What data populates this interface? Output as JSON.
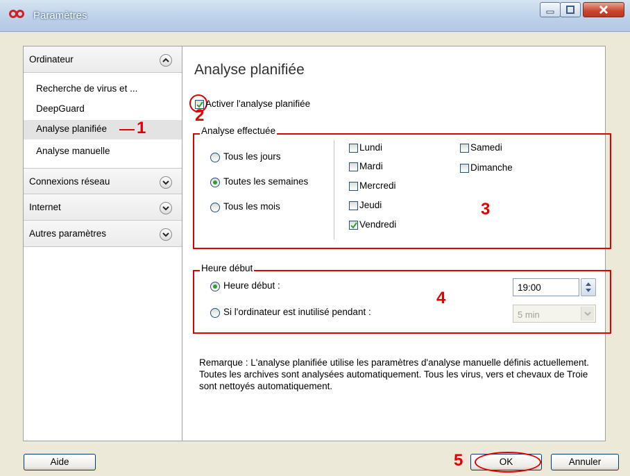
{
  "window": {
    "title": "Paramètres"
  },
  "sidebar": {
    "categories": [
      {
        "label": "Ordinateur",
        "expanded": true
      },
      {
        "label": "Connexions réseau"
      },
      {
        "label": "Internet"
      },
      {
        "label": "Autres paramètres"
      }
    ],
    "items": [
      {
        "label": "Recherche de virus et ..."
      },
      {
        "label": "DeepGuard"
      },
      {
        "label": "Analyse planifiée",
        "selected": true
      },
      {
        "label": "Analyse manuelle"
      }
    ]
  },
  "main": {
    "title": "Analyse planifiée",
    "enable_checkbox": {
      "label": "Activer l'analyse planifiée",
      "checked": true
    },
    "frequency_group": {
      "legend": "Analyse effectuée",
      "options": [
        {
          "label": "Tous les jours",
          "selected": false
        },
        {
          "label": "Toutes les semaines",
          "selected": true
        },
        {
          "label": "Tous les mois",
          "selected": false
        }
      ],
      "days": [
        {
          "label": "Lundi",
          "checked": false
        },
        {
          "label": "Mardi",
          "checked": false
        },
        {
          "label": "Mercredi",
          "checked": false
        },
        {
          "label": "Jeudi",
          "checked": false
        },
        {
          "label": "Vendredi",
          "checked": true
        },
        {
          "label": "Samedi",
          "checked": false
        },
        {
          "label": "Dimanche",
          "checked": false
        }
      ]
    },
    "start_group": {
      "legend": "Heure début",
      "start_time_label": "Heure début :",
      "start_time_value": "19:00",
      "idle_label": "Si l'ordinateur est inutilisé pendant :",
      "idle_value": "5 min"
    },
    "note": "Remarque : L'analyse planifiée utilise les paramètres d'analyse manuelle définis actuellement. Toutes les archives sont analysées automatiquement. Tous les virus, vers et chevaux de Troie sont nettoyés automatiquement."
  },
  "buttons": {
    "help": "Aide",
    "ok": "OK",
    "cancel": "Annuler"
  },
  "annotations": [
    "1",
    "2",
    "3",
    "4",
    "5"
  ],
  "colors": {
    "annotation": "#e00000",
    "radio_dot": "#2fa030",
    "check": "#2fa030"
  }
}
